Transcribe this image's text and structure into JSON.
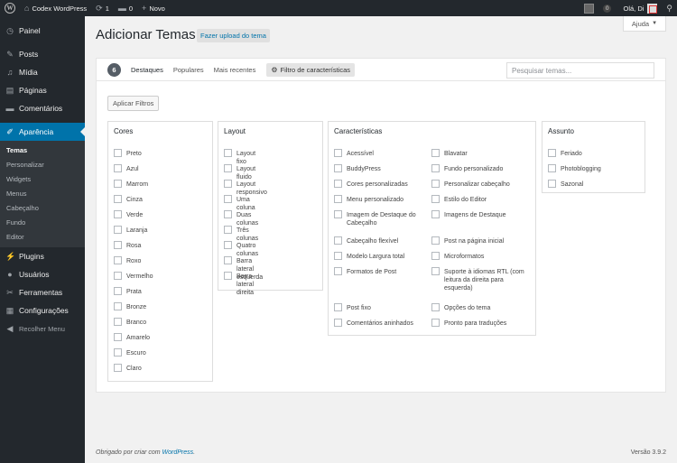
{
  "adminbar": {
    "site_name": "Codex WordPress",
    "updates_count": "1",
    "comments_count": "0",
    "new_label": "Novo",
    "pending_count": "0",
    "greeting": "Olá, Di"
  },
  "sidebar": {
    "items_top": [
      {
        "label": "Painel",
        "icon": "dashboard-icon",
        "glyph": "◷"
      }
    ],
    "items_mid": [
      {
        "label": "Posts",
        "icon": "pin-icon",
        "glyph": "✎"
      },
      {
        "label": "Mídia",
        "icon": "media-icon",
        "glyph": "♫"
      },
      {
        "label": "Páginas",
        "icon": "pages-icon",
        "glyph": "▤"
      },
      {
        "label": "Comentários",
        "icon": "comments-icon",
        "glyph": "▬"
      }
    ],
    "current": {
      "label": "Aparência",
      "icon": "appearance-icon",
      "glyph": "✐"
    },
    "submenu": [
      "Temas",
      "Personalizar",
      "Widgets",
      "Menus",
      "Cabeçalho",
      "Fundo",
      "Editor"
    ],
    "items_bottom": [
      {
        "label": "Plugins",
        "icon": "plugins-icon",
        "glyph": "⚡"
      },
      {
        "label": "Usuários",
        "icon": "users-icon",
        "glyph": "●"
      },
      {
        "label": "Ferramentas",
        "icon": "tools-icon",
        "glyph": "✂"
      },
      {
        "label": "Configurações",
        "icon": "settings-icon",
        "glyph": "▦"
      }
    ],
    "collapse_label": "Recolher Menu"
  },
  "header": {
    "title": "Adicionar Temas",
    "upload_label": "Fazer upload do tema",
    "help_label": "Ajuda"
  },
  "filter_bar": {
    "count": "6",
    "links": [
      "Destaques",
      "Populares",
      "Mais recentes"
    ],
    "feature_filter_label": "Filtro de características",
    "search_placeholder": "Pesquisar temas..."
  },
  "drawer": {
    "apply_label": "Aplicar Filtros",
    "groups": {
      "cores": {
        "title": "Cores",
        "options": [
          "Preto",
          "Azul",
          "Marrom",
          "Cinza",
          "Verde",
          "Laranja",
          "Rosa",
          "Roxo",
          "Vermelho",
          "Prata",
          "Bronze",
          "Branco",
          "Amarelo",
          "Escuro",
          "Claro"
        ]
      },
      "layout": {
        "title": "Layout",
        "options": [
          "Layout fixo",
          "Layout fluido",
          "Layout responsivo",
          "Uma coluna",
          "Duas colunas",
          "Três colunas",
          "Quatro colunas",
          "Barra lateral esquerda",
          "Barra lateral direita"
        ]
      },
      "caracteristicas": {
        "title": "Características",
        "left": [
          "Acessível",
          "BuddyPress",
          "Cores personalizadas",
          "Menu personalizado",
          "Imagem de Destaque do Cabeçalho",
          "Cabeçalho flexível",
          "Modelo Largura total",
          "Formatos de Post",
          "Post fixo",
          "Comentários aninhados"
        ],
        "right": [
          "Blavatar",
          "Fundo personalizado",
          "Personalizar cabeçalho",
          "Estilo do Editor",
          "Imagens de Destaque",
          "Post na página inicial",
          "Microformatos",
          "Suporte à idiomas RTL (com leitura da direita para esquerda)",
          "Opções do tema",
          "Pronto para traduções"
        ]
      },
      "assunto": {
        "title": "Assunto",
        "options": [
          "Feriado",
          "Photoblogging",
          "Sazonal"
        ]
      }
    }
  },
  "footer": {
    "thanks_prefix": "Obrigado por criar com ",
    "wordpress_link": "WordPress",
    "thanks_suffix": ".",
    "version": "Versão 3.9.2"
  },
  "colors": {
    "adminbar_bg": "#23282d",
    "accent": "#0073aa",
    "page_bg": "#f1f1f1"
  }
}
